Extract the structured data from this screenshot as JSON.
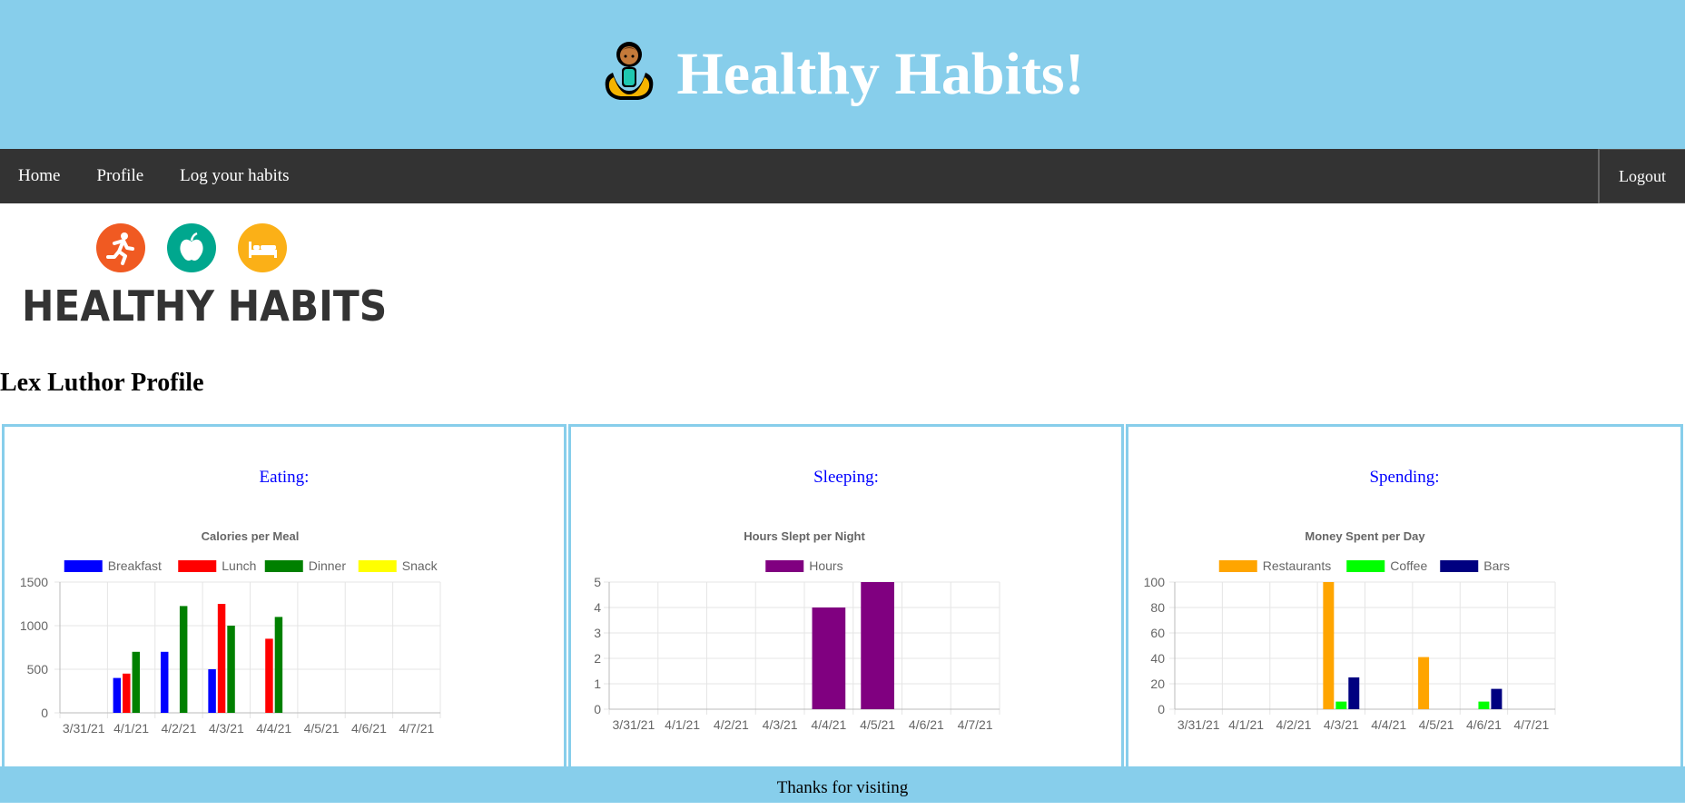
{
  "header": {
    "title": "Healthy Habits!",
    "icon": "person-meditating-icon"
  },
  "nav": {
    "items": [
      {
        "label": "Home"
      },
      {
        "label": "Profile"
      },
      {
        "label": "Log your habits"
      }
    ],
    "logout_label": "Logout"
  },
  "logo": {
    "text": "HEALTHY HABITS",
    "icons": [
      {
        "name": "running-icon",
        "color": "#f05a22"
      },
      {
        "name": "apple-icon",
        "color": "#00a78e"
      },
      {
        "name": "bed-icon",
        "color": "#fbb017"
      }
    ]
  },
  "profile": {
    "title": "Lex Luthor Profile"
  },
  "panels": [
    {
      "title": "Eating:"
    },
    {
      "title": "Sleeping:"
    },
    {
      "title": "Spending:"
    }
  ],
  "chart_data": [
    {
      "type": "bar",
      "title": "Calories per Meal",
      "categories": [
        "3/31/21",
        "4/1/21",
        "4/2/21",
        "4/3/21",
        "4/4/21",
        "4/5/21",
        "4/6/21",
        "4/7/21"
      ],
      "series": [
        {
          "name": "Breakfast",
          "color": "#0000ff",
          "values": [
            null,
            400,
            700,
            500,
            null,
            null,
            null,
            null
          ]
        },
        {
          "name": "Lunch",
          "color": "#ff0000",
          "values": [
            null,
            450,
            null,
            1250,
            850,
            null,
            null,
            null
          ]
        },
        {
          "name": "Dinner",
          "color": "#008000",
          "values": [
            null,
            700,
            1225,
            1000,
            1100,
            null,
            null,
            null
          ]
        },
        {
          "name": "Snack",
          "color": "#ffff00",
          "values": [
            null,
            null,
            null,
            null,
            null,
            null,
            null,
            null
          ]
        }
      ],
      "ylim": [
        0,
        1500
      ],
      "yticks": [
        0,
        500,
        1000,
        1500
      ],
      "legend": "top",
      "grid": true
    },
    {
      "type": "bar",
      "title": "Hours Slept per Night",
      "categories": [
        "3/31/21",
        "4/1/21",
        "4/2/21",
        "4/3/21",
        "4/4/21",
        "4/5/21",
        "4/6/21",
        "4/7/21"
      ],
      "series": [
        {
          "name": "Hours",
          "color": "#800080",
          "values": [
            null,
            null,
            null,
            null,
            4,
            5,
            null,
            null
          ]
        }
      ],
      "ylim": [
        0,
        5
      ],
      "yticks": [
        0,
        1,
        2,
        3,
        4,
        5
      ],
      "legend": "top",
      "grid": true
    },
    {
      "type": "bar",
      "title": "Money Spent per Day",
      "categories": [
        "3/31/21",
        "4/1/21",
        "4/2/21",
        "4/3/21",
        "4/4/21",
        "4/5/21",
        "4/6/21",
        "4/7/21"
      ],
      "series": [
        {
          "name": "Restaurants",
          "color": "#ffa500",
          "values": [
            null,
            null,
            null,
            100,
            null,
            41,
            null,
            null
          ]
        },
        {
          "name": "Coffee",
          "color": "#00ff00",
          "values": [
            null,
            null,
            null,
            6,
            null,
            null,
            6,
            null
          ]
        },
        {
          "name": "Bars",
          "color": "#000080",
          "values": [
            null,
            null,
            null,
            25,
            null,
            null,
            16,
            null
          ]
        }
      ],
      "ylim": [
        0,
        100
      ],
      "yticks": [
        0,
        20,
        40,
        60,
        80,
        100
      ],
      "legend": "top",
      "grid": true
    }
  ],
  "footer": {
    "text": "Thanks for visiting"
  }
}
